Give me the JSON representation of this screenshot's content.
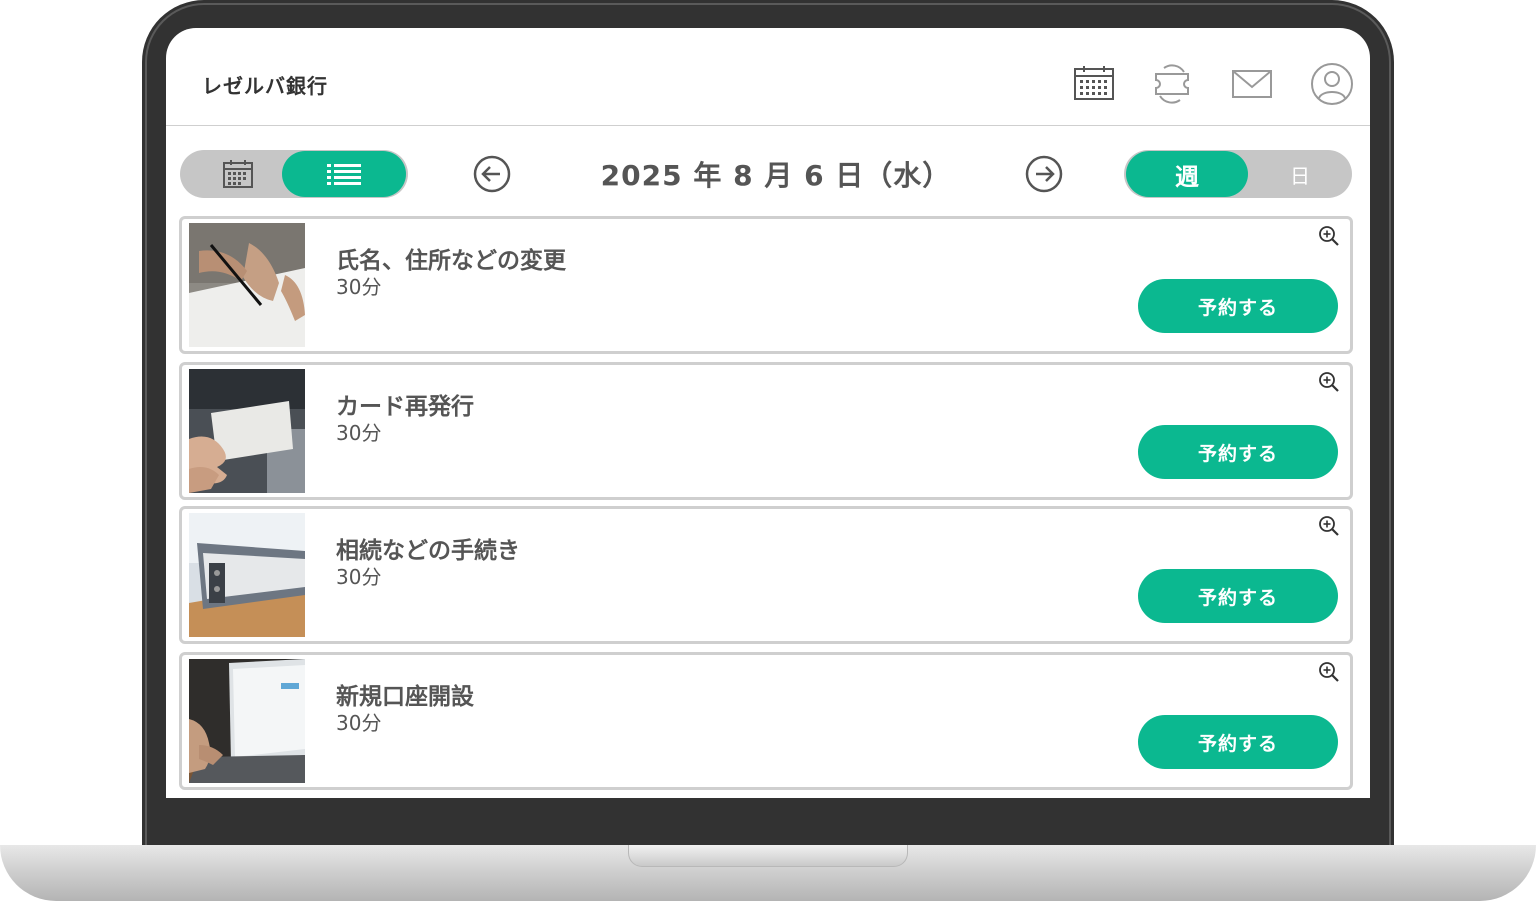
{
  "app": {
    "brand": "レゼルバ銀行"
  },
  "header_icons": [
    {
      "name": "calendar-icon"
    },
    {
      "name": "ticket-icon"
    },
    {
      "name": "mail-icon"
    },
    {
      "name": "user-icon"
    }
  ],
  "toolbar": {
    "date": "2025 年 8 月 6 日（水）",
    "range_week": "週",
    "range_day": "日",
    "active_view": "list",
    "active_range": "week"
  },
  "services": [
    {
      "title": "氏名、住所などの変更",
      "duration": "30分",
      "button": "予約する",
      "image": "hand-writing-photo"
    },
    {
      "title": "カード再発行",
      "duration": "30分",
      "button": "予約する",
      "image": "card-in-hand-photo"
    },
    {
      "title": "相続などの手続き",
      "duration": "30分",
      "button": "予約する",
      "image": "binder-photo"
    },
    {
      "title": "新規口座開設",
      "duration": "30分",
      "button": "予約する",
      "image": "laptop-typing-photo"
    }
  ],
  "colors": {
    "accent": "#0bb890",
    "toggle_bg": "#c6c6c6",
    "frame": "#323232"
  }
}
